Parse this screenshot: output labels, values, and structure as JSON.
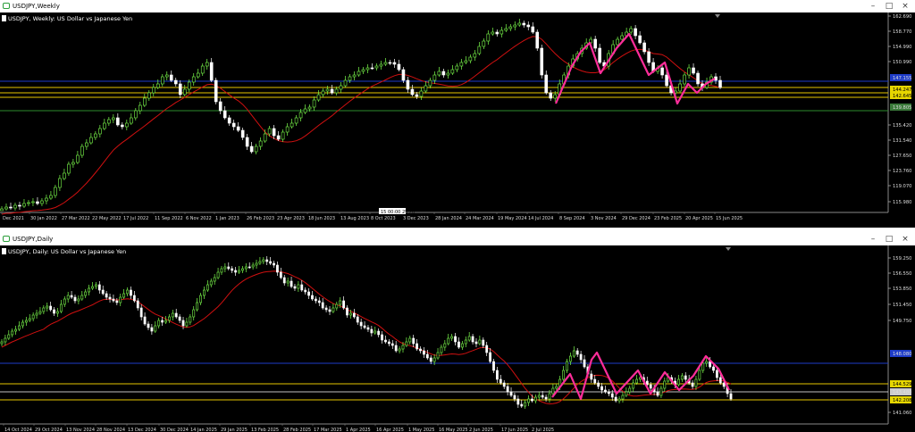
{
  "weekly": {
    "window_title": "USDJPY,Weekly",
    "chart_label": "USDJPY, Weekly:  US Dollar vs Japanese Yen",
    "price_labels": [
      "162.690",
      "158.770",
      "154.990",
      "150.990",
      "147.155",
      "144.247",
      "142.645",
      "139.805",
      "135.420",
      "131.540",
      "127.650",
      "123.760",
      "119.070",
      "115.980"
    ],
    "date_labels": [
      "Dec 2021",
      "30 Jan 2022",
      "27 Mar 2022",
      "22 May 2022",
      "17 Jul 2022",
      "11 Sep 2022",
      "6 Nov 2022",
      "1 Jan 2023",
      "26 Feb 2023",
      "23 Apr 2023",
      "18 Jun 2023",
      "13 Aug 2023",
      "8 Oct 2023",
      "3 Dec 2023",
      "28 Jan 2024",
      "24 Mar 2024",
      "19 May 2024",
      "14 Jul 2024",
      "8 Sep 2024",
      "3 Nov 2024",
      "29 Dec 2024",
      "23 Feb 2025",
      "20 Apr 2025",
      "15 Jun 2025"
    ],
    "crosshair_label": "15 00:00  29.20"
  },
  "daily": {
    "window_title": "USDJPY,Daily",
    "chart_label": "USDJPY, Daily:  US Dollar vs Japanese Yen",
    "price_labels": [
      "159.250",
      "156.550",
      "153.850",
      "151.450",
      "149.750",
      "148.080",
      "144.529",
      "143.480",
      "142.208",
      "141.060"
    ],
    "date_labels": [
      "14 Oct 2024",
      "29 Oct 2024",
      "13 Nov 2024",
      "28 Nov 2024",
      "13 Dec 2024",
      "30 Dec 2024",
      "14 Jan 2025",
      "29 Jan 2025",
      "13 Feb 2025",
      "28 Feb 2025",
      "17 Mar 2025",
      "1 Apr 2025",
      "16 Apr 2025",
      "1 May 2025",
      "16 May 2025",
      "2 Jun 2025",
      "17 Jun 2025",
      "2 Jul 2025"
    ]
  },
  "window_buttons": {
    "minimize": "–",
    "maximize": "□",
    "close": "×"
  },
  "colors": {
    "background": "#000000",
    "bull_candle": "#7CFC4C",
    "bear_candle": "#FFFFFF",
    "moving_average": "#D01010",
    "zigzag": "#FF2D9A",
    "support_lines": "#E6C600",
    "blue_line": "#1E3CC8",
    "green_line": "#2E8B2E",
    "price_tag_blue": "#1E3CC8",
    "price_tag_yellow": "#E6D600"
  }
}
